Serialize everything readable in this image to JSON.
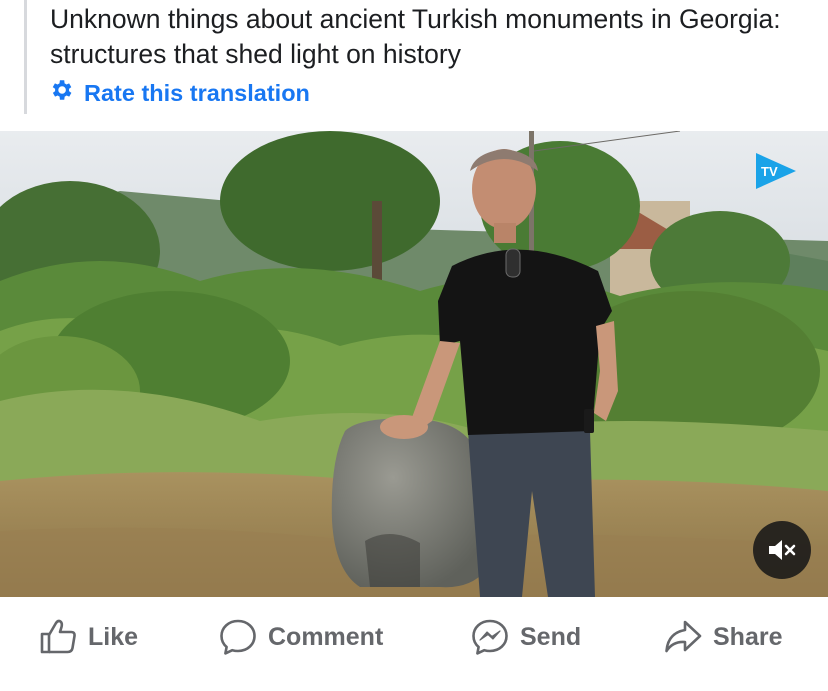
{
  "post": {
    "title": "Unknown things about ancient Turkish monuments in Georgia: structures that shed light on history",
    "rate_translation": "Rate this translation"
  },
  "video": {
    "channel_logo_text": "TV",
    "mute_icon": "speaker-muted-icon"
  },
  "actions": {
    "like": "Like",
    "comment": "Comment",
    "send": "Send",
    "share": "Share"
  },
  "colors": {
    "link": "#1877f2",
    "action_text": "#65676b",
    "title_text": "#1c1e21",
    "logo_blue": "#1aa3e8"
  }
}
